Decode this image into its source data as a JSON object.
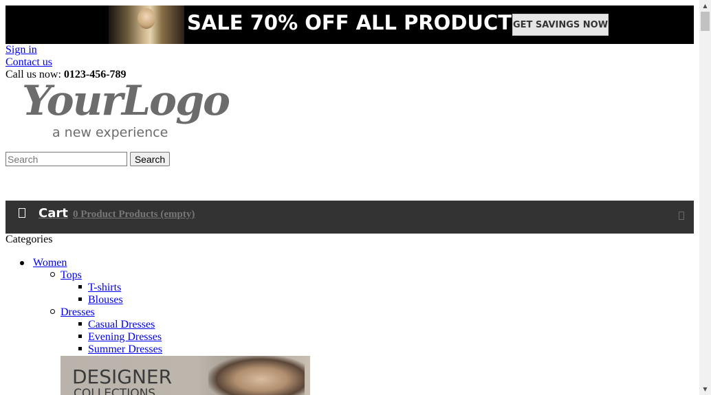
{
  "banner": {
    "headline": "SALE 70% OFF ALL PRODUCTS",
    "cta_label": "GET SAVINGS NOW"
  },
  "header": {
    "sign_in": "Sign in",
    "contact_us": "Contact us",
    "call_us_prefix": "Call us now: ",
    "phone": "0123-456-789"
  },
  "logo": {
    "main": "YourLogo",
    "tagline": "a new experience"
  },
  "search": {
    "placeholder": "Search",
    "value": "",
    "button_label": "Search"
  },
  "cart": {
    "label": "Cart",
    "summary": "0 Product Products (empty)",
    "icon": "cart-icon",
    "toggle_icon": "chevron-down-icon"
  },
  "categories": {
    "title": "Categories",
    "items": [
      {
        "label": "Women",
        "level": 0
      },
      {
        "label": "Tops",
        "level": 1
      },
      {
        "label": "T-shirts",
        "level": 2
      },
      {
        "label": "Blouses",
        "level": 2
      },
      {
        "label": "Dresses",
        "level": 1
      },
      {
        "label": "Casual Dresses",
        "level": 2
      },
      {
        "label": "Evening Dresses",
        "level": 2
      },
      {
        "label": "Summer Dresses",
        "level": 2
      }
    ]
  },
  "promo": {
    "title": "DESIGNER",
    "subtitle": "COLLECTIONS"
  },
  "colors": {
    "cart_bar": "#333333",
    "link": "#0000ee",
    "banner_bg": "#000000"
  }
}
